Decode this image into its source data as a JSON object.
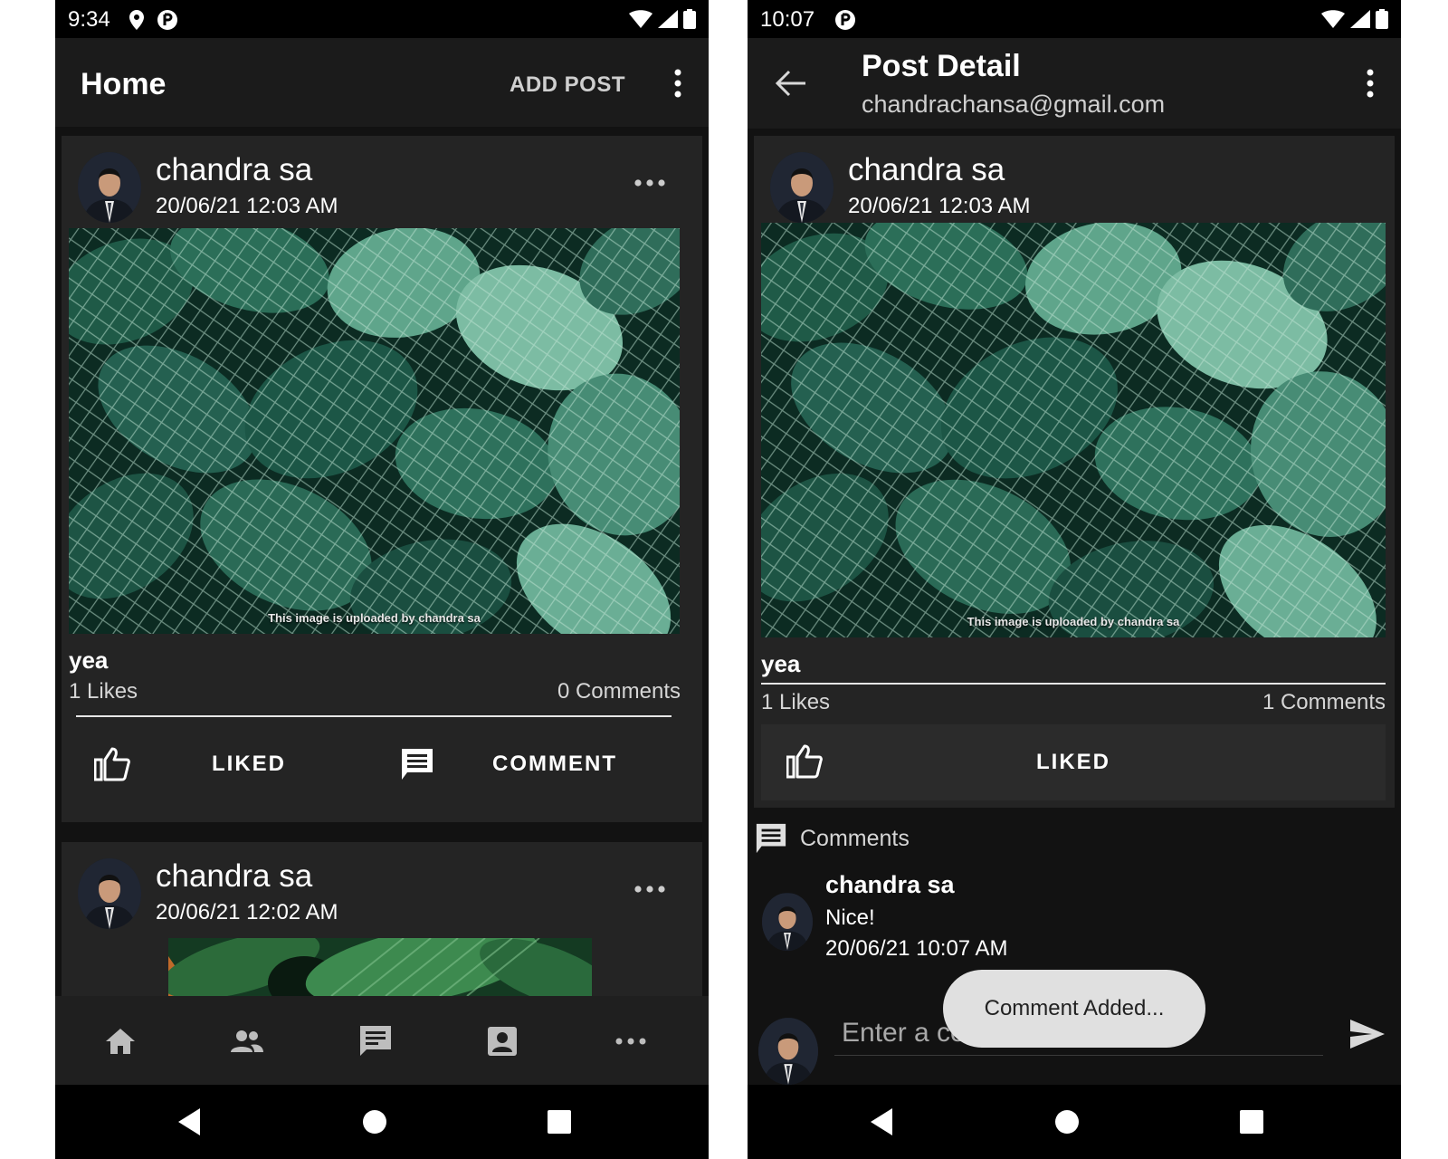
{
  "colors": {
    "background": "#121212",
    "card": "#242424",
    "app_bar": "#1b1b1b",
    "status_bar": "#000000",
    "toast": "#e0e0e0"
  },
  "left": {
    "status": {
      "time": "9:34"
    },
    "app_bar": {
      "title": "Home",
      "action": "ADD POST"
    },
    "posts": [
      {
        "author": "chandra sa",
        "time": "20/06/21 12:03 AM",
        "watermark": "This image is uploaded by chandra sa",
        "caption": "yea",
        "likes": "1 Likes",
        "comments": "0 Comments",
        "like_label": "LIKED",
        "comment_label": "COMMENT"
      },
      {
        "author": "chandra sa",
        "time": "20/06/21 12:02 AM"
      }
    ],
    "bottom_nav": [
      "home-icon",
      "people-icon",
      "chat-icon",
      "profile-icon",
      "more-icon"
    ]
  },
  "right": {
    "status": {
      "time": "10:07"
    },
    "app_bar": {
      "title": "Post Detail",
      "subtitle": "chandrachansa@gmail.com"
    },
    "post": {
      "author": "chandra sa",
      "time": "20/06/21 12:03 AM",
      "watermark": "This image is uploaded by chandra sa",
      "caption": "yea",
      "likes": "1 Likes",
      "comments": "1 Comments",
      "like_label": "LIKED"
    },
    "comments_header": "Comments",
    "comment": {
      "author": "chandra sa",
      "text": "Nice!",
      "time": "20/06/21 10:07 AM"
    },
    "input": {
      "placeholder": "Enter a comment..."
    },
    "toast": "Comment Added..."
  }
}
